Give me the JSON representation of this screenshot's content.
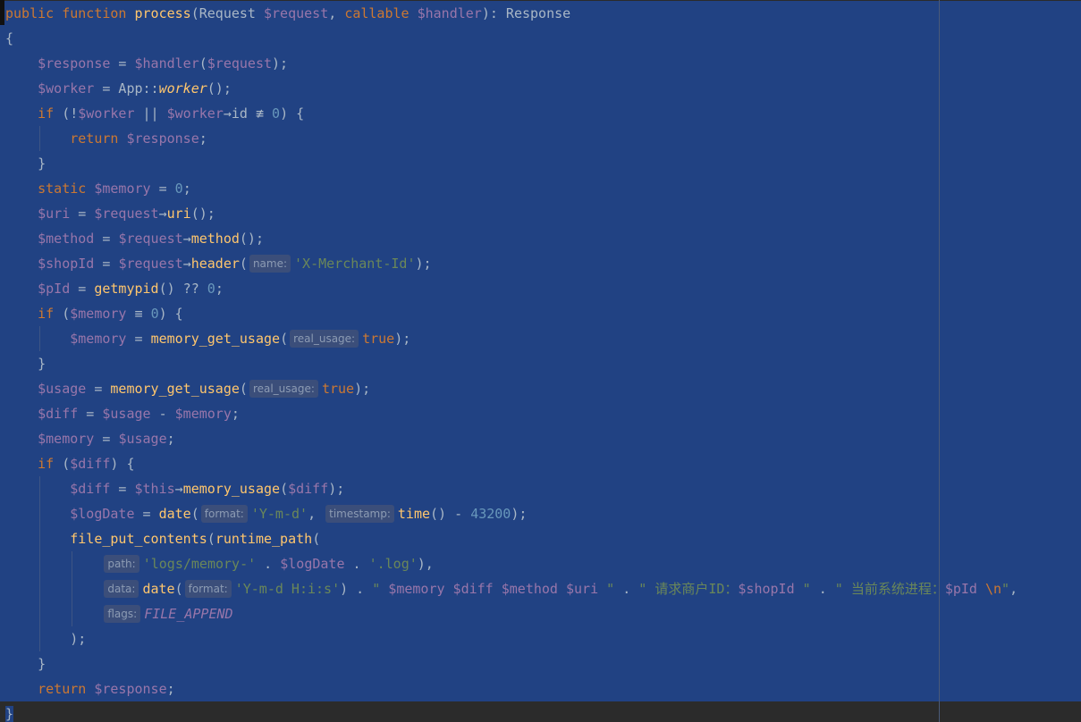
{
  "editor": {
    "language": "php",
    "selection": "lines 1-28 selected",
    "hint_color": "#8c9bb3",
    "selection_color": "#214283",
    "lines": [
      [
        [
          "kw",
          "public function "
        ],
        [
          "fn",
          "process"
        ],
        [
          "p",
          "(Request "
        ],
        [
          "var",
          "$request"
        ],
        [
          "p",
          ", "
        ],
        [
          "kw",
          "callable "
        ],
        [
          "var",
          "$handler"
        ],
        [
          "p",
          "): Response"
        ]
      ],
      [
        [
          "p",
          "{"
        ]
      ],
      [
        [
          "i",
          "    "
        ],
        [
          "var",
          "$response"
        ],
        [
          "p",
          " = "
        ],
        [
          "var",
          "$handler"
        ],
        [
          "p",
          "("
        ],
        [
          "var",
          "$request"
        ],
        [
          "p",
          ");"
        ]
      ],
      [
        [
          "i",
          "    "
        ],
        [
          "var",
          "$worker"
        ],
        [
          "p",
          " = App::"
        ],
        [
          "fni",
          "worker"
        ],
        [
          "p",
          "();"
        ]
      ],
      [
        [
          "i",
          "    "
        ],
        [
          "kw",
          "if "
        ],
        [
          "p",
          "(!"
        ],
        [
          "var",
          "$worker"
        ],
        [
          "p",
          " || "
        ],
        [
          "var",
          "$worker"
        ],
        [
          "p",
          "→id ≢ "
        ],
        [
          "num",
          "0"
        ],
        [
          "p",
          ") {"
        ]
      ],
      [
        [
          "i",
          "        "
        ],
        [
          "kw",
          "return "
        ],
        [
          "var",
          "$response"
        ],
        [
          "p",
          ";"
        ]
      ],
      [
        [
          "i",
          "    "
        ],
        [
          "p",
          "}"
        ]
      ],
      [
        [
          "i",
          "    "
        ],
        [
          "kw",
          "static "
        ],
        [
          "var",
          "$memory"
        ],
        [
          "p",
          " = "
        ],
        [
          "num",
          "0"
        ],
        [
          "p",
          ";"
        ]
      ],
      [
        [
          "i",
          "    "
        ],
        [
          "var",
          "$uri"
        ],
        [
          "p",
          " = "
        ],
        [
          "var",
          "$request"
        ],
        [
          "p",
          "→"
        ],
        [
          "fn",
          "uri"
        ],
        [
          "p",
          "();"
        ]
      ],
      [
        [
          "i",
          "    "
        ],
        [
          "var",
          "$method"
        ],
        [
          "p",
          " = "
        ],
        [
          "var",
          "$request"
        ],
        [
          "p",
          "→"
        ],
        [
          "fn",
          "method"
        ],
        [
          "p",
          "();"
        ]
      ],
      [
        [
          "i",
          "    "
        ],
        [
          "var",
          "$shopId"
        ],
        [
          "p",
          " = "
        ],
        [
          "var",
          "$request"
        ],
        [
          "p",
          "→"
        ],
        [
          "fn",
          "header"
        ],
        [
          "p",
          "("
        ],
        [
          "hint",
          "name:"
        ],
        [
          "str",
          "'X-Merchant-Id'"
        ],
        [
          "p",
          ");"
        ]
      ],
      [
        [
          "i",
          "    "
        ],
        [
          "var",
          "$pId"
        ],
        [
          "p",
          " = "
        ],
        [
          "fn",
          "getmypid"
        ],
        [
          "p",
          "() ?? "
        ],
        [
          "num",
          "0"
        ],
        [
          "p",
          ";"
        ]
      ],
      [
        [
          "i",
          "    "
        ],
        [
          "kw",
          "if "
        ],
        [
          "p",
          "("
        ],
        [
          "var",
          "$memory"
        ],
        [
          "p",
          " ≡ "
        ],
        [
          "num",
          "0"
        ],
        [
          "p",
          ") {"
        ]
      ],
      [
        [
          "i",
          "        "
        ],
        [
          "var",
          "$memory"
        ],
        [
          "p",
          " = "
        ],
        [
          "fn",
          "memory_get_usage"
        ],
        [
          "p",
          "("
        ],
        [
          "hint",
          "real_usage:"
        ],
        [
          "kw",
          "true"
        ],
        [
          "p",
          ");"
        ]
      ],
      [
        [
          "i",
          "    "
        ],
        [
          "p",
          "}"
        ]
      ],
      [
        [
          "i",
          "    "
        ],
        [
          "var",
          "$usage"
        ],
        [
          "p",
          " = "
        ],
        [
          "fn",
          "memory_get_usage"
        ],
        [
          "p",
          "("
        ],
        [
          "hint",
          "real_usage:"
        ],
        [
          "kw",
          "true"
        ],
        [
          "p",
          ");"
        ]
      ],
      [
        [
          "i",
          "    "
        ],
        [
          "var",
          "$diff"
        ],
        [
          "p",
          " = "
        ],
        [
          "var",
          "$usage"
        ],
        [
          "p",
          " - "
        ],
        [
          "var",
          "$memory"
        ],
        [
          "p",
          ";"
        ]
      ],
      [
        [
          "i",
          "    "
        ],
        [
          "var",
          "$memory"
        ],
        [
          "p",
          " = "
        ],
        [
          "var",
          "$usage"
        ],
        [
          "p",
          ";"
        ]
      ],
      [
        [
          "i",
          "    "
        ],
        [
          "kw",
          "if "
        ],
        [
          "p",
          "("
        ],
        [
          "var",
          "$diff"
        ],
        [
          "p",
          ") {"
        ]
      ],
      [
        [
          "i",
          "        "
        ],
        [
          "var",
          "$diff"
        ],
        [
          "p",
          " = "
        ],
        [
          "var",
          "$this"
        ],
        [
          "p",
          "→"
        ],
        [
          "fn",
          "memory_usage"
        ],
        [
          "p",
          "("
        ],
        [
          "var",
          "$diff"
        ],
        [
          "p",
          ");"
        ]
      ],
      [
        [
          "i",
          "        "
        ],
        [
          "var",
          "$logDate"
        ],
        [
          "p",
          " = "
        ],
        [
          "fn",
          "date"
        ],
        [
          "p",
          "("
        ],
        [
          "hint",
          "format:"
        ],
        [
          "str",
          "'Y-m-d'"
        ],
        [
          "p",
          ", "
        ],
        [
          "hint",
          "timestamp:"
        ],
        [
          "fn",
          "time"
        ],
        [
          "p",
          "() - "
        ],
        [
          "num",
          "43200"
        ],
        [
          "p",
          ");"
        ]
      ],
      [
        [
          "i",
          "        "
        ],
        [
          "fn",
          "file_put_contents"
        ],
        [
          "p",
          "("
        ],
        [
          "fn",
          "runtime_path"
        ],
        [
          "p",
          "("
        ]
      ],
      [
        [
          "i",
          "            "
        ],
        [
          "hint",
          "path:"
        ],
        [
          "str",
          "'logs/memory-'"
        ],
        [
          "p",
          " . "
        ],
        [
          "var",
          "$logDate"
        ],
        [
          "p",
          " . "
        ],
        [
          "str",
          "'.log'"
        ],
        [
          "p",
          "),"
        ]
      ],
      [
        [
          "i",
          "            "
        ],
        [
          "hint",
          "data:"
        ],
        [
          "fn",
          "date"
        ],
        [
          "p",
          "("
        ],
        [
          "hint",
          "format:"
        ],
        [
          "str",
          "'Y-m-d H:i:s'"
        ],
        [
          "p",
          ") . "
        ],
        [
          "str",
          "\" "
        ],
        [
          "var",
          "$memory"
        ],
        [
          "str",
          " "
        ],
        [
          "var",
          "$diff"
        ],
        [
          "str",
          " "
        ],
        [
          "var",
          "$method"
        ],
        [
          "str",
          " "
        ],
        [
          "var",
          "$uri"
        ],
        [
          "str",
          " \""
        ],
        [
          "p",
          " . "
        ],
        [
          "str",
          "\" 请求商户ID："
        ],
        [
          "var",
          "$shopId"
        ],
        [
          "str",
          " \""
        ],
        [
          "p",
          " . "
        ],
        [
          "str",
          "\" 当前系统进程："
        ],
        [
          "var",
          "$pId"
        ],
        [
          "str",
          " "
        ],
        [
          "kw",
          "\\n"
        ],
        [
          "str",
          "\""
        ],
        [
          "p",
          ","
        ]
      ],
      [
        [
          "i",
          "            "
        ],
        [
          "hint",
          "flags:"
        ],
        [
          "cst",
          "FILE_APPEND"
        ]
      ],
      [
        [
          "i",
          "        "
        ],
        [
          "p",
          ");"
        ]
      ],
      [
        [
          "i",
          "    "
        ],
        [
          "p",
          "}"
        ]
      ],
      [
        [
          "i",
          "    "
        ],
        [
          "kw",
          "return "
        ],
        [
          "var",
          "$response"
        ],
        [
          "p",
          ";"
        ]
      ],
      [
        [
          "p",
          "}"
        ]
      ]
    ]
  }
}
